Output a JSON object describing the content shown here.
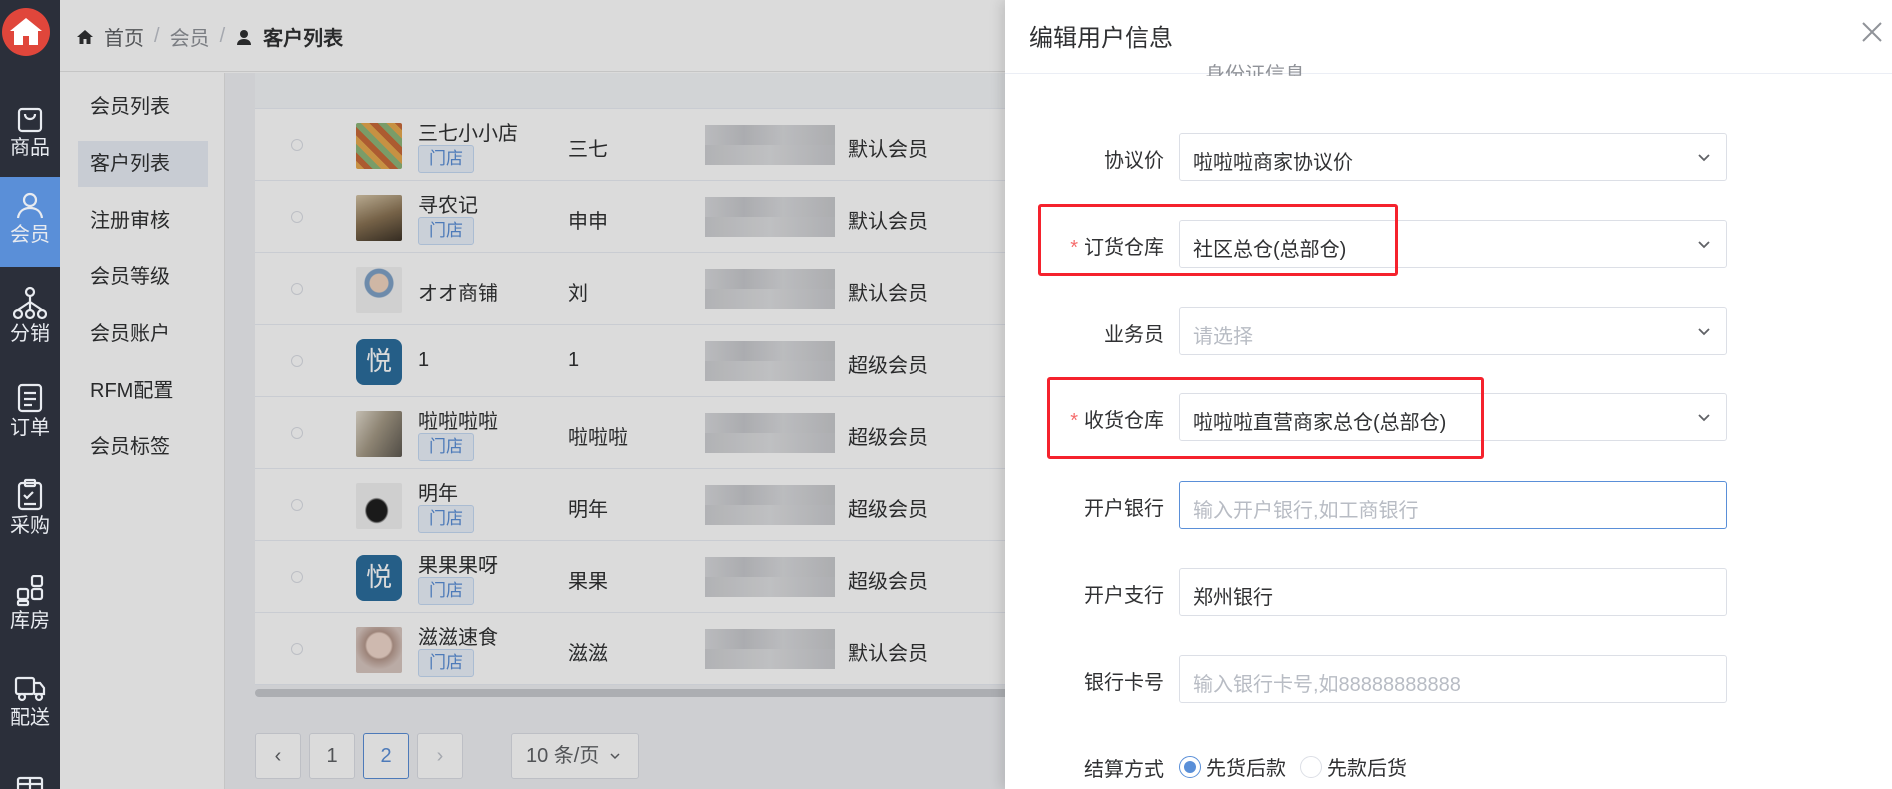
{
  "rail": {
    "items": [
      {
        "label": "商品",
        "icon": "bag-icon"
      },
      {
        "label": "会员",
        "icon": "user-icon"
      },
      {
        "label": "分销",
        "icon": "network-icon"
      },
      {
        "label": "订单",
        "icon": "order-icon"
      },
      {
        "label": "采购",
        "icon": "clipboard-icon"
      },
      {
        "label": "库房",
        "icon": "grid-icon"
      },
      {
        "label": "配送",
        "icon": "truck-icon"
      }
    ],
    "active_index": 1,
    "active_color": "#5a8fd8"
  },
  "breadcrumb": {
    "home": "首页",
    "level2": "会员",
    "current": "客户列表"
  },
  "submenu": {
    "items": [
      "会员列表",
      "客户列表",
      "注册审核",
      "会员等级",
      "会员账户",
      "RFM配置",
      "会员标签"
    ],
    "active_index": 1
  },
  "table": {
    "rows": [
      {
        "name": "三七小小店",
        "tag": "门店",
        "contact": "三七",
        "level": "默认会员"
      },
      {
        "name": "寻农记",
        "tag": "门店",
        "contact": "申申",
        "level": "默认会员"
      },
      {
        "name": "オオ商铺",
        "tag": "",
        "contact": "刘",
        "level": "默认会员"
      },
      {
        "name": "1",
        "tag": "",
        "contact": "1",
        "level": "超级会员"
      },
      {
        "name": "啦啦啦啦",
        "tag": "门店",
        "contact": "啦啦啦",
        "level": "超级会员"
      },
      {
        "name": "明年",
        "tag": "门店",
        "contact": "明年",
        "level": "超级会员"
      },
      {
        "name": "果果果呀",
        "tag": "门店",
        "contact": "果果",
        "level": "超级会员"
      },
      {
        "name": "滋滋速食",
        "tag": "门店",
        "contact": "滋滋",
        "level": "默认会员"
      }
    ]
  },
  "pagination": {
    "prev": "‹",
    "pages": [
      "1",
      "2"
    ],
    "current": "2",
    "next": "›",
    "page_size": "10 条/页"
  },
  "drawer": {
    "title": "编辑用户信息",
    "cut_off_text": "身份证信息",
    "fields": {
      "agreement_price": {
        "label": "协议价",
        "value": "啦啦啦商家协议价",
        "required": false
      },
      "order_warehouse": {
        "label": "订货仓库",
        "value": "社区总仓(总部仓)",
        "required": true
      },
      "salesperson": {
        "label": "业务员",
        "placeholder": "请选择",
        "required": false
      },
      "receive_warehouse": {
        "label": "收货仓库",
        "value": "啦啦啦直营商家总仓(总部仓)",
        "required": true
      },
      "bank": {
        "label": "开户银行",
        "placeholder": "输入开户银行,如工商银行"
      },
      "branch": {
        "label": "开户支行",
        "value": "郑州银行"
      },
      "card_no": {
        "label": "银行卡号",
        "placeholder": "输入银行卡号,如88888888888"
      },
      "settlement": {
        "label": "结算方式",
        "options": [
          "先货后款",
          "先款后货"
        ],
        "selected": "先货后款"
      }
    },
    "highlight_color": "#f5222d"
  }
}
